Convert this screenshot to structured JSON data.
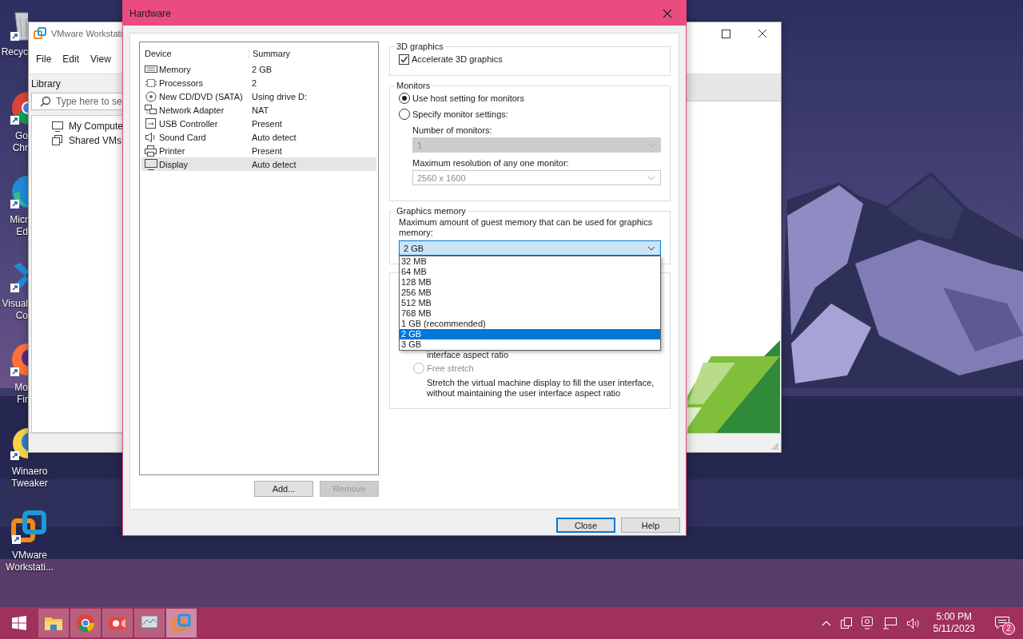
{
  "desktop_icons": [
    {
      "kind": "recycle-bin",
      "lines": [
        "Recyc"
      ]
    },
    {
      "kind": "chrome",
      "lines": [
        "Go",
        "Chr"
      ]
    },
    {
      "kind": "edge",
      "lines": [
        "Micr",
        "Ed"
      ]
    },
    {
      "kind": "vscode",
      "lines": [
        "Visual",
        "Co"
      ]
    },
    {
      "kind": "firefox",
      "lines": [
        "Mo",
        "Fir"
      ]
    },
    {
      "kind": "winaero",
      "lines": [
        "Winaero",
        "Tweaker"
      ]
    },
    {
      "kind": "vmware",
      "lines": [
        "VMware",
        "Workstati..."
      ]
    }
  ],
  "background_window": {
    "title": "VMware Workstati",
    "menu": [
      "File",
      "Edit",
      "View"
    ],
    "library_label": "Library",
    "search_placeholder": "Type here to se",
    "tree": [
      {
        "kind": "computer",
        "label": "My Compute"
      },
      {
        "kind": "shared",
        "label": "Shared VMs"
      }
    ]
  },
  "dialog": {
    "title": "Hardware",
    "devices": {
      "columns": [
        "Device",
        "Summary"
      ],
      "rows": [
        {
          "kind": "memory",
          "device": "Memory",
          "summary": "2 GB",
          "selected": false
        },
        {
          "kind": "processor",
          "device": "Processors",
          "summary": "2",
          "selected": false
        },
        {
          "kind": "cd",
          "device": "New CD/DVD (SATA)",
          "summary": "Using drive D:",
          "selected": false
        },
        {
          "kind": "network",
          "device": "Network Adapter",
          "summary": "NAT",
          "selected": false
        },
        {
          "kind": "usb",
          "device": "USB Controller",
          "summary": "Present",
          "selected": false
        },
        {
          "kind": "sound",
          "device": "Sound Card",
          "summary": "Auto detect",
          "selected": false
        },
        {
          "kind": "printer",
          "device": "Printer",
          "summary": "Present",
          "selected": false
        },
        {
          "kind": "display",
          "device": "Display",
          "summary": "Auto detect",
          "selected": true
        }
      ]
    },
    "list_buttons": [
      {
        "label": "Add...",
        "disabled": false
      },
      {
        "label": "Remove",
        "disabled": true
      }
    ],
    "graphics_3d": {
      "legend": "3D graphics",
      "label": "Accelerate 3D graphics",
      "checked": true
    },
    "monitors": {
      "legend": "Monitors",
      "options": [
        {
          "label": "Use host setting for monitors",
          "selected": true
        },
        {
          "label": "Specify monitor settings:",
          "selected": false
        }
      ],
      "number_label": "Number of monitors:",
      "number_value": "1",
      "number_disabled": true,
      "resolution_label": "Maximum resolution of any one monitor:",
      "resolution_value": "2560 x 1600",
      "resolution_disabled": true
    },
    "graphics_memory": {
      "legend": "Graphics memory",
      "description": "Maximum amount of guest memory that can be used for graphics memory:",
      "value": "2 GB",
      "expanded": true,
      "options": [
        {
          "label": "32 MB",
          "selected": false
        },
        {
          "label": "64 MB",
          "selected": false
        },
        {
          "label": "128 MB",
          "selected": false
        },
        {
          "label": "256 MB",
          "selected": false
        },
        {
          "label": "512 MB",
          "selected": false
        },
        {
          "label": "768 MB",
          "selected": false
        },
        {
          "label": "1 GB (recommended)",
          "selected": false
        },
        {
          "label": "2 GB",
          "selected": true
        },
        {
          "label": "3 GB",
          "selected": false
        }
      ]
    },
    "display_scaling": {
      "partial_text": "interface aspect ratio",
      "option": {
        "label": "Free stretch",
        "selected": false,
        "disabled": true
      },
      "description": "Stretch the virtual machine display to fill the user interface, without maintaining the user interface aspect ratio"
    },
    "footer_buttons": [
      {
        "label": "Close",
        "default": true
      },
      {
        "label": "Help",
        "default": false
      }
    ]
  },
  "taskbar": {
    "apps": [
      {
        "kind": "folder",
        "selected": false
      },
      {
        "kind": "chrome",
        "selected": false
      },
      {
        "kind": "recorder",
        "selected": false
      },
      {
        "kind": "monitor",
        "selected": false
      },
      {
        "kind": "vmware",
        "selected": true
      }
    ],
    "time": "5:00 PM",
    "date": "5/11/2023",
    "notifications": "2"
  }
}
